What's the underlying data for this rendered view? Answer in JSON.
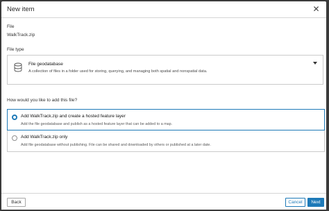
{
  "dialog": {
    "title": "New item",
    "close_icon": "close-icon"
  },
  "file": {
    "label": "File",
    "value": "WalkTrack.zip"
  },
  "file_type": {
    "label": "File type",
    "icon": "database-icon",
    "selected_title": "File geodatabase",
    "selected_description": "A collection of files in a folder used for storing, querying, and managing both spatial and nonspatial data."
  },
  "add_method": {
    "question": "How would you like to add this file?",
    "options": [
      {
        "title": "Add WalkTrack.zip and create a hosted feature layer",
        "description": "Add the file geodatabase and publish as a hosted feature layer that can be added to a map.",
        "selected": true
      },
      {
        "title": "Add WalkTrack.zip only",
        "description": "Add file geodatabase without publishing. File can be shared and downloaded by others or published at a later date.",
        "selected": false
      }
    ]
  },
  "footer": {
    "back_label": "Back",
    "cancel_label": "Cancel",
    "next_label": "Next"
  },
  "colors": {
    "accent": "#1e7ab8",
    "border": "#cacaca"
  }
}
